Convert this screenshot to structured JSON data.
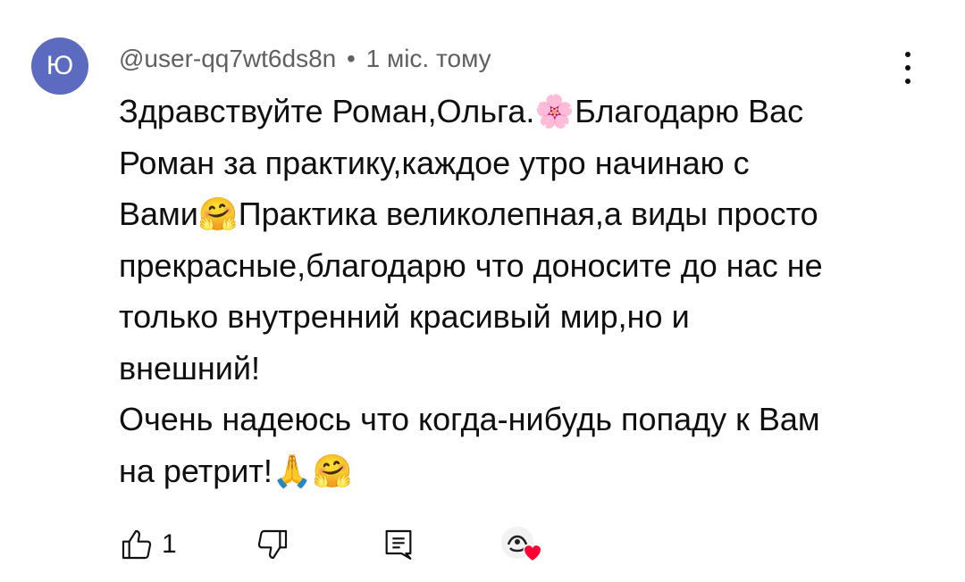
{
  "comment": {
    "avatar_letter": "Ю",
    "avatar_color": "#5c6bc0",
    "author": "@user-qq7wt6ds8n",
    "separator": "•",
    "time": "1 міс. тому",
    "text": "Здравствуйте Роман,Ольга.🌸Благодарю Вас\nРоман за практику,каждое утро начинаю с\nВами🤗Практика великолепная,а виды просто\nпрекрасные,благодарю что доносите до нас не\nтолько внутренний красивый мир,но и\nвнешний!\nОчень надеюсь что когда-нибудь попаду к Вам\nна ретрит!🙏🤗"
  },
  "actions": {
    "like_icon": "thumbs-up-icon",
    "like_count": "1",
    "dislike_icon": "thumbs-down-icon",
    "reply_icon": "comment-reply-icon",
    "creator_heart_icon": "creator-heart-icon",
    "heart_color": "#ff0033"
  },
  "menu_icon": "more-vertical-icon"
}
